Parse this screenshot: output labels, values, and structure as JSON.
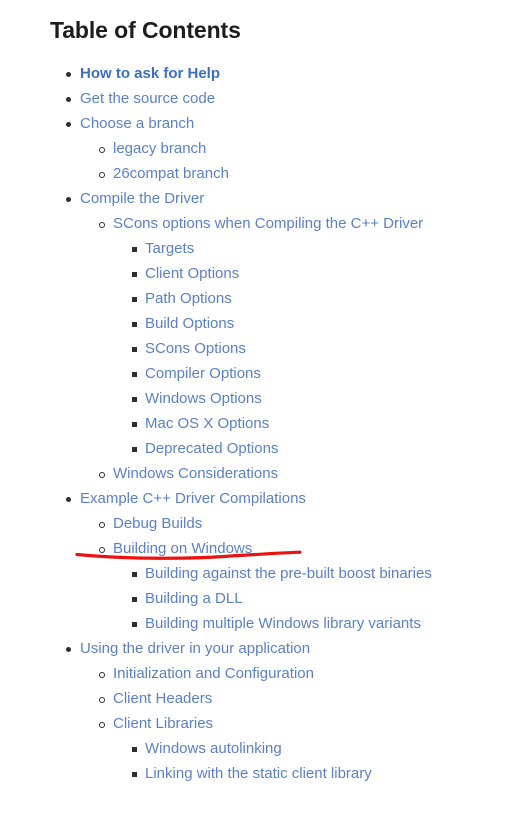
{
  "page": {
    "background_color": "#ffffff",
    "title": "Table of Contents"
  },
  "colors": {
    "heading": "#1d1d1d",
    "link": "#5b80c4",
    "link_bold": "#3c6fbf",
    "bullet": "#2d2d2d",
    "annotation_red": "#ee1111"
  },
  "toc": {
    "heading": "Table of Contents",
    "items": [
      {
        "label": "How to ask for Help",
        "level": 1,
        "bold": true
      },
      {
        "label": "Get the source code",
        "level": 1,
        "bold": false
      },
      {
        "label": "Choose a branch",
        "level": 1,
        "bold": false
      },
      {
        "label": "legacy branch",
        "level": 2,
        "bold": false
      },
      {
        "label": "26compat branch",
        "level": 2,
        "bold": false
      },
      {
        "label": "Compile the Driver",
        "level": 1,
        "bold": false
      },
      {
        "label": "SCons options when Compiling the C++ Driver",
        "level": 2,
        "bold": false
      },
      {
        "label": "Targets",
        "level": 3,
        "bold": false
      },
      {
        "label": "Client Options",
        "level": 3,
        "bold": false
      },
      {
        "label": "Path Options",
        "level": 3,
        "bold": false
      },
      {
        "label": "Build Options",
        "level": 3,
        "bold": false
      },
      {
        "label": "SCons Options",
        "level": 3,
        "bold": false
      },
      {
        "label": "Compiler Options",
        "level": 3,
        "bold": false
      },
      {
        "label": "Windows Options",
        "level": 3,
        "bold": false
      },
      {
        "label": "Mac OS X Options",
        "level": 3,
        "bold": false
      },
      {
        "label": "Deprecated Options",
        "level": 3,
        "bold": false
      },
      {
        "label": "Windows Considerations",
        "level": 2,
        "bold": false
      },
      {
        "label": "Example C++ Driver Compilations",
        "level": 1,
        "bold": false
      },
      {
        "label": "Debug Builds",
        "level": 2,
        "bold": false
      },
      {
        "label": "Building on Windows",
        "level": 2,
        "bold": false,
        "annotated": true
      },
      {
        "label": "Building against the pre-built boost binaries",
        "level": 3,
        "bold": false
      },
      {
        "label": "Building a DLL",
        "level": 3,
        "bold": false
      },
      {
        "label": "Building multiple Windows library variants",
        "level": 3,
        "bold": false
      },
      {
        "label": "Using the driver in your application",
        "level": 1,
        "bold": false
      },
      {
        "label": "Initialization and Configuration",
        "level": 2,
        "bold": false
      },
      {
        "label": "Client Headers",
        "level": 2,
        "bold": false
      },
      {
        "label": "Client Libraries",
        "level": 2,
        "bold": false
      },
      {
        "label": "Windows autolinking",
        "level": 3,
        "bold": false
      },
      {
        "label": "Linking with the static client library",
        "level": 3,
        "bold": false
      }
    ]
  },
  "annotation": {
    "type": "red-underline",
    "targets": "Building on Windows",
    "color": "#ee1111"
  }
}
